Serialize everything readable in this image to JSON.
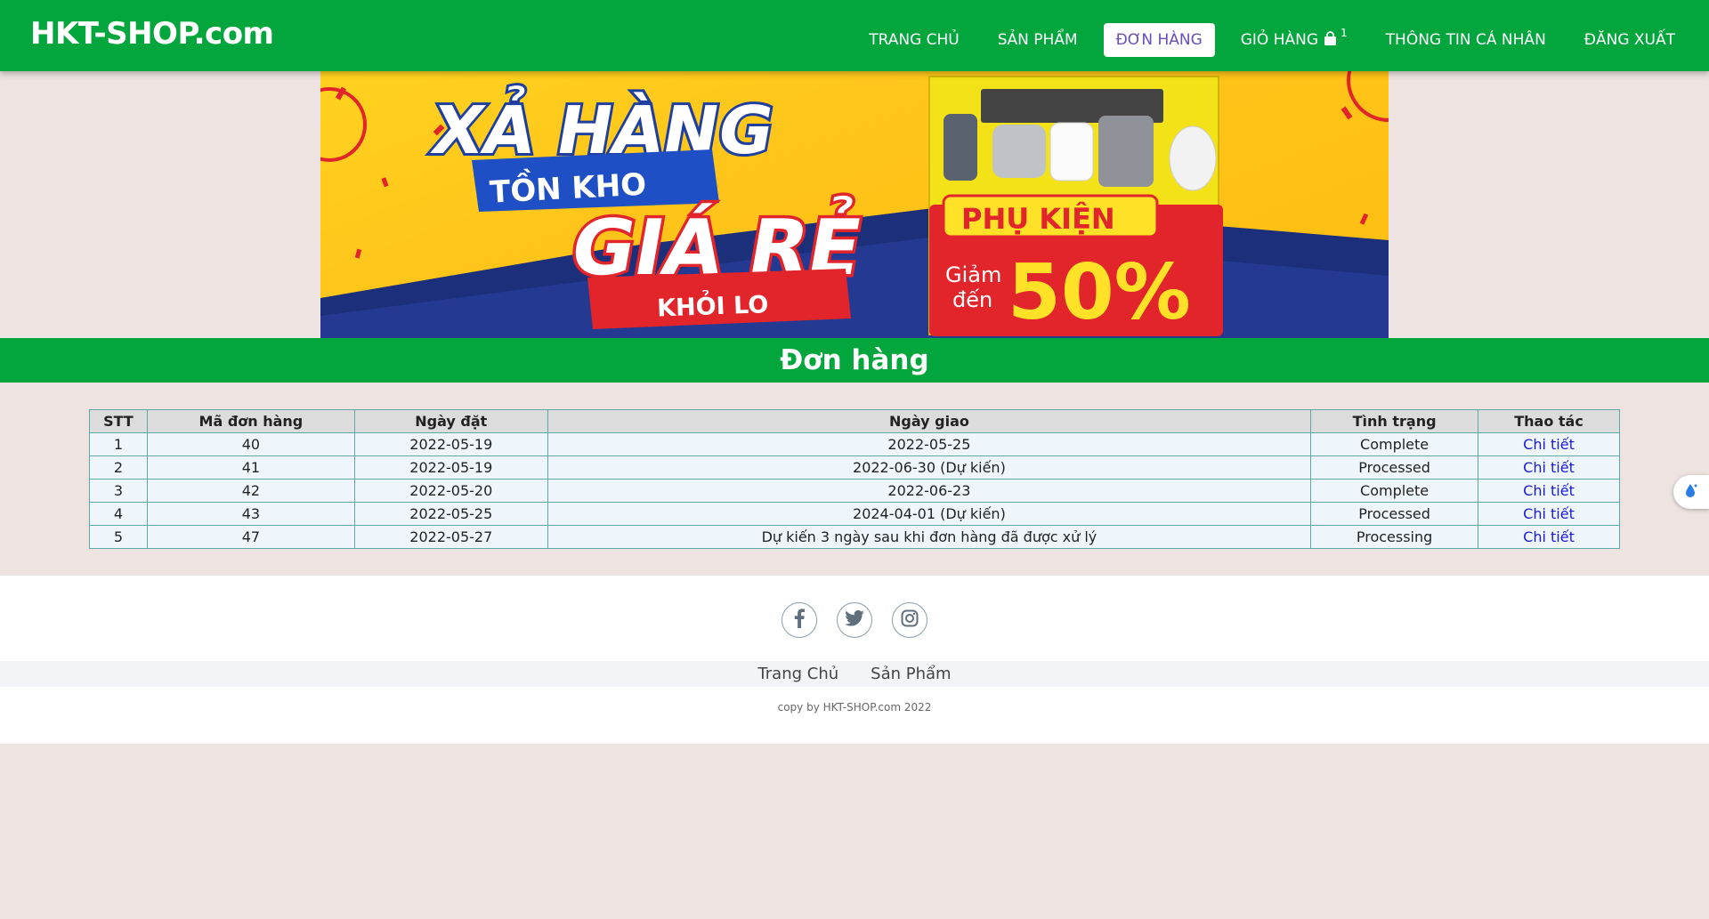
{
  "brand": "HKT-SHOP.com",
  "nav": {
    "home": "TRANG CHỦ",
    "products": "SẢN PHẨM",
    "orders": "ĐƠN HÀNG",
    "cart": "GIỎ HÀNG",
    "cart_count": "1",
    "profile": "THÔNG TIN CÁ NHÂN",
    "logout": "ĐĂNG XUẤT"
  },
  "banner": {
    "line1": "XẢ HÀNG",
    "line2": "TỒN KHO",
    "line3": "GIÁ RẺ",
    "line4": "KHỎI LO",
    "accessory": "PHỤ KIỆN",
    "discount_prefix_1": "Giảm",
    "discount_prefix_2": "đến",
    "discount": "50%"
  },
  "page_title": "Đơn hàng",
  "table": {
    "headers": [
      "STT",
      "Mã đơn hàng",
      "Ngày đặt",
      "Ngày giao",
      "Tình trạng",
      "Thao tác"
    ],
    "rows": [
      {
        "stt": "1",
        "id": "40",
        "order_date": "2022-05-19",
        "delivery": "2022-05-25",
        "status": "Complete",
        "action": "Chi tiết"
      },
      {
        "stt": "2",
        "id": "41",
        "order_date": "2022-05-19",
        "delivery": "2022-06-30 (Dự kiến)",
        "status": "Processed",
        "action": "Chi tiết"
      },
      {
        "stt": "3",
        "id": "42",
        "order_date": "2022-05-20",
        "delivery": "2022-06-23",
        "status": "Complete",
        "action": "Chi tiết"
      },
      {
        "stt": "4",
        "id": "43",
        "order_date": "2022-05-25",
        "delivery": "2024-04-01 (Dự kiến)",
        "status": "Processed",
        "action": "Chi tiết"
      },
      {
        "stt": "5",
        "id": "47",
        "order_date": "2022-05-27",
        "delivery": "Dự kiến 3 ngày sau khi đơn hàng đã được xử lý",
        "status": "Processing",
        "action": "Chi tiết"
      }
    ]
  },
  "footer": {
    "socials": [
      "facebook-icon",
      "twitter-icon",
      "instagram-icon"
    ],
    "links": [
      "Trang Chủ",
      "Sản Phẩm"
    ],
    "copy": "copy by HKT-SHOP.com 2022"
  },
  "colors": {
    "primary_green": "#03a63c",
    "page_bg": "#ede3e1",
    "active_nav_text": "#6b4eb6",
    "link_blue": "#1a1ad6"
  }
}
